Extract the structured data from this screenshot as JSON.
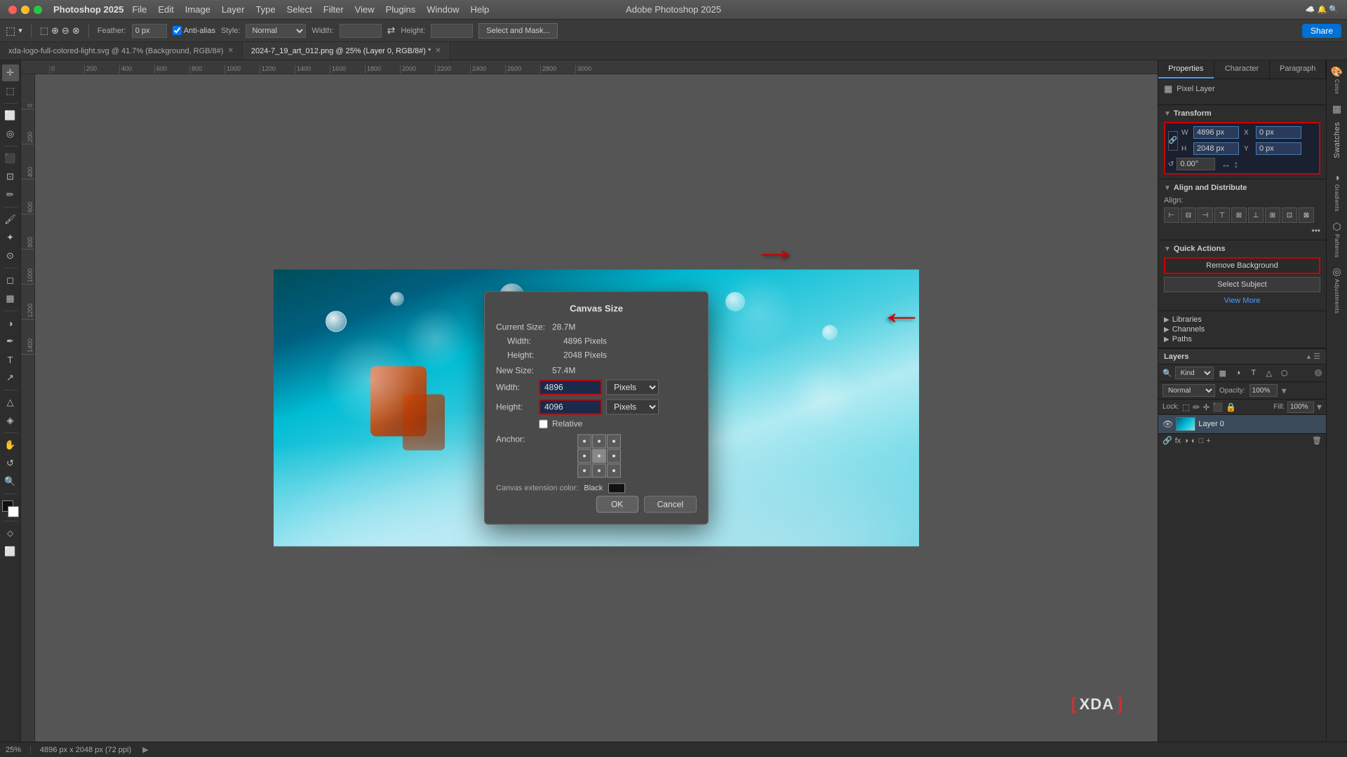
{
  "app": {
    "name": "Photoshop 2025",
    "full_title": "Adobe Photoshop 2025",
    "version": "2025"
  },
  "titlebar": {
    "dots": [
      "red",
      "yellow",
      "green"
    ],
    "menu_items": [
      "File",
      "Edit",
      "Image",
      "Layer",
      "Type",
      "Select",
      "Filter",
      "View",
      "Plugins",
      "Window",
      "Help"
    ]
  },
  "toolbar": {
    "feather_label": "Feather:",
    "feather_value": "0 px",
    "anti_alias": "Anti-alias",
    "style_label": "Style:",
    "style_value": "Normal",
    "width_label": "Width:",
    "height_label": "Height:",
    "select_mask_btn": "Select and Mask...",
    "share_btn": "Share"
  },
  "tabs": [
    {
      "label": "xda-logo-full-colored-light.svg @ 41.7% (Background, RGB/8#)",
      "active": false
    },
    {
      "label": "2024-7_19_art_012.png @ 25% (Layer 0, RGB/8#) *",
      "active": true
    }
  ],
  "canvas": {
    "zoom": "25%",
    "dimensions": "4896 px x 2048 px (72 ppi)"
  },
  "dialog": {
    "title": "Canvas Size",
    "current_size_label": "Current Size:",
    "current_size_value": "28.7M",
    "width_label": "Width:",
    "width_value": "4896 Pixels",
    "height_label": "Height:",
    "height_value": "2048 Pixels",
    "new_size_label": "New Size:",
    "new_size_value": "57.4M",
    "input_width_label": "Width:",
    "input_width_value": "4896",
    "input_height_label": "Height:",
    "input_height_value": "4096",
    "unit_width": "Pixels",
    "unit_height": "Pixels",
    "relative_label": "Relative",
    "anchor_label": "Anchor:",
    "canvas_ext_color_label": "Canvas extension color:",
    "canvas_ext_color_value": "Black",
    "ok_btn": "OK",
    "cancel_btn": "Cancel"
  },
  "properties": {
    "title": "Properties",
    "character_tab": "Character",
    "paragraph_tab": "Paragraph",
    "layer_type": "Pixel Layer",
    "transform_section": "Transform",
    "w_label": "W",
    "h_label": "H",
    "x_label": "X",
    "y_label": "Y",
    "w_value": "4896 px",
    "h_value": "2048 px",
    "x_value": "0 px",
    "y_value": "0 px",
    "rotation_value": "0.00°",
    "align_section": "Align and Distribute",
    "align_label": "Align:",
    "quick_actions_section": "Quick Actions",
    "remove_bg_btn": "Remove Background",
    "select_subject_btn": "Select Subject",
    "view_more_link": "View More",
    "libraries_label": "Libraries",
    "channels_label": "Channels",
    "paths_label": "Paths"
  },
  "layers": {
    "title": "Layers",
    "kind_select": "Kind",
    "blend_mode": "Normal",
    "opacity_label": "Opacity:",
    "opacity_value": "100%",
    "lock_label": "Lock:",
    "fill_label": "Fill:",
    "fill_value": "100%",
    "layer_name": "Layer 0"
  },
  "right_panel_tabs": {
    "swatches": "Swatches",
    "gradients": "Gradients",
    "patterns": "Patterns",
    "adjustments": "Adjustments"
  }
}
